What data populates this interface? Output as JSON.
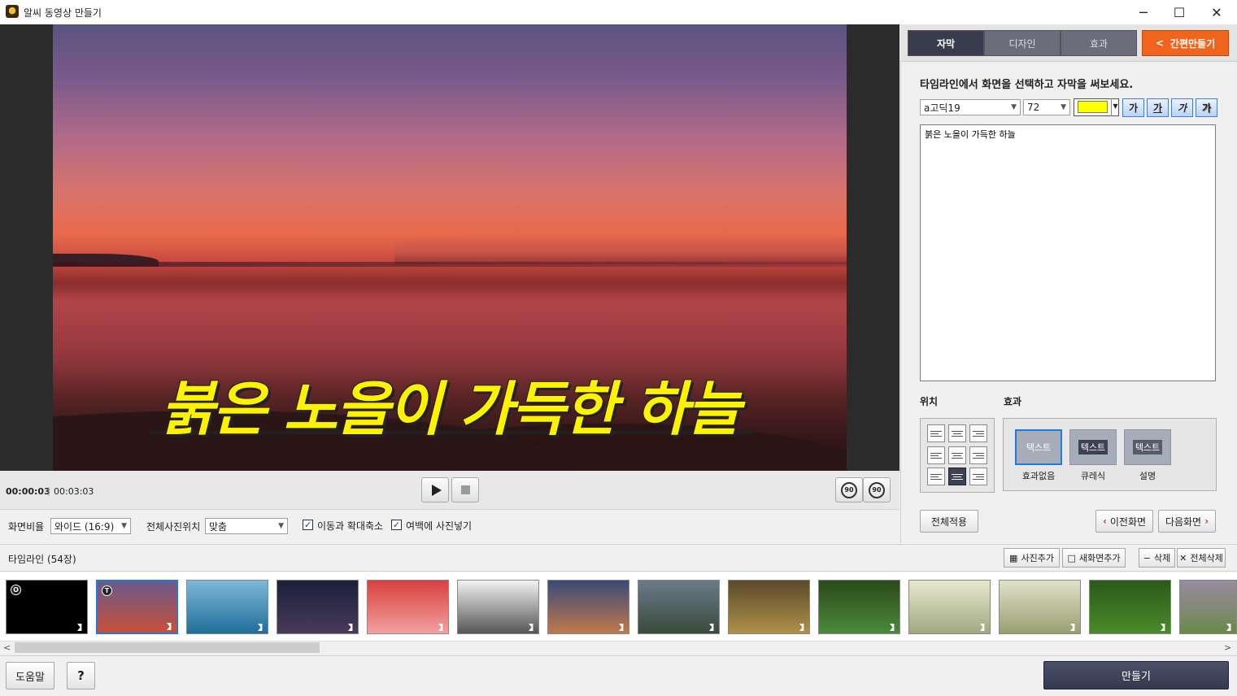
{
  "window": {
    "title": "알씨 동영상 만들기",
    "minimize": "─",
    "maximize": "☐",
    "close": "✕"
  },
  "preview": {
    "subtitle_text": "붉은 노을이 가득한 하늘"
  },
  "playback": {
    "current_time": "00:00:03",
    "separator": "|",
    "total_time": "00:03:03",
    "rotate_left": "90",
    "rotate_right": "90"
  },
  "options": {
    "aspect_label": "화면비율",
    "aspect_value": "와이드 (16:9)",
    "photo_pos_label": "전체사진위치",
    "photo_pos_value": "맞춤",
    "pan_zoom_label": "이동과 확대축소",
    "pan_zoom_checked": true,
    "fill_margin_label": "여백에 사진넣기",
    "fill_margin_checked": true
  },
  "tabs": [
    {
      "label": "자막",
      "active": true
    },
    {
      "label": "디자인",
      "active": false
    },
    {
      "label": "효과",
      "active": false
    }
  ],
  "quick_make": {
    "label": "간편만들기",
    "chevron": "<"
  },
  "subtitle_panel": {
    "instruction": "타임라인에서 화면을 선택하고 자막을 써보세요.",
    "font": "a고딕19",
    "size": "72",
    "color": "#ffff00",
    "style_buttons": [
      "가",
      "가",
      "가",
      "가"
    ],
    "text": "붉은 노을이 가득한 하늘",
    "position_label": "위치",
    "effect_label": "효과",
    "effects": [
      {
        "thumb": "텍스트",
        "caption": "효과없음",
        "selected": true
      },
      {
        "thumb": "텍스트",
        "caption": "큐레식",
        "selected": false
      },
      {
        "thumb": "텍스트",
        "caption": "설명",
        "selected": false
      }
    ],
    "apply_all": "전체적용",
    "prev_screen": "이전화면",
    "next_screen": "다음화면"
  },
  "timeline": {
    "title": "타임라인 (54장)",
    "add_photo": "사진추가",
    "add_screen": "새화면추가",
    "delete": "삭제",
    "delete_all": "전체삭제",
    "thumbs": [
      {
        "badge": "O",
        "colors": [
          "#000000",
          "#000000"
        ]
      },
      {
        "badge": "T",
        "colors": [
          "#6a5a8a",
          "#c8503a"
        ],
        "selected": true
      },
      {
        "badge": "",
        "colors": [
          "#7fb8d8",
          "#1f6e9a"
        ]
      },
      {
        "badge": "",
        "colors": [
          "#1a1f3a",
          "#4a3a5a"
        ]
      },
      {
        "badge": "",
        "colors": [
          "#d84040",
          "#f3a0a0"
        ]
      },
      {
        "badge": "",
        "colors": [
          "#f2f2f2",
          "#555555"
        ]
      },
      {
        "badge": "",
        "colors": [
          "#3a4a7a",
          "#c07a4a"
        ]
      },
      {
        "badge": "",
        "colors": [
          "#6a7a8a",
          "#3a4a3a"
        ]
      },
      {
        "badge": "",
        "colors": [
          "#5a4a2a",
          "#b0904a"
        ]
      },
      {
        "badge": "",
        "colors": [
          "#2a4a1a",
          "#4a8a3a"
        ]
      },
      {
        "badge": "",
        "colors": [
          "#e8e8d0",
          "#a0a880"
        ]
      },
      {
        "badge": "",
        "colors": [
          "#e0e0c8",
          "#9aa070"
        ]
      },
      {
        "badge": "",
        "colors": [
          "#2a5a1a",
          "#4a8a2a"
        ]
      },
      {
        "badge": "",
        "colors": [
          "#9a8aa0",
          "#6a8a4a"
        ]
      }
    ],
    "scroll_left": "<",
    "scroll_right": ">"
  },
  "bottom": {
    "help": "도움말",
    "question": "?",
    "make": "만들기"
  }
}
